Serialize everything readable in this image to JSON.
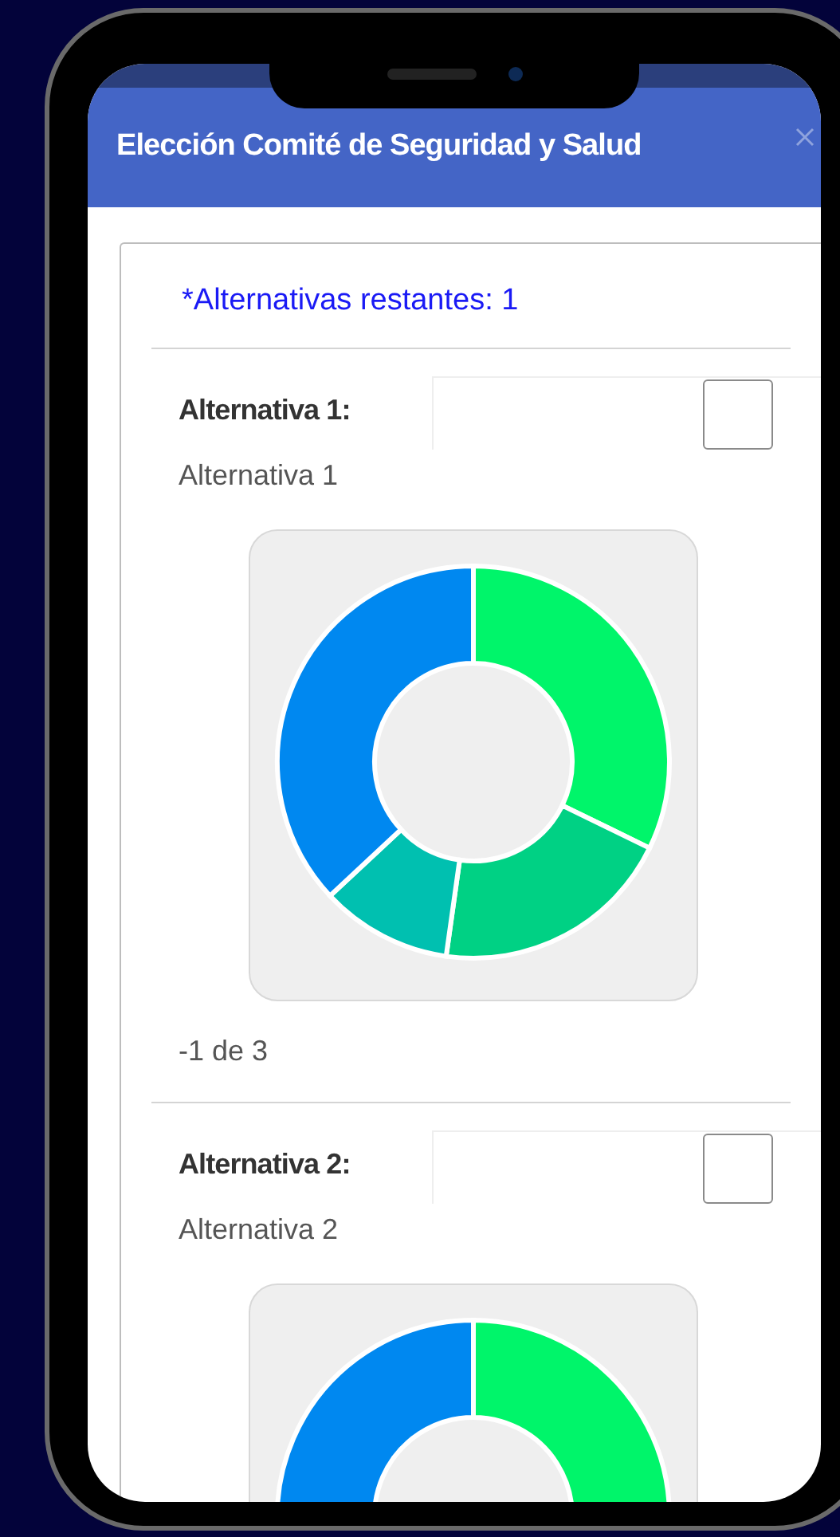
{
  "window": {
    "title": "Elección Comité de Seguridad y Salud"
  },
  "remaining": "*Alternativas restantes: 1",
  "alternatives": [
    {
      "label": "Alternativa 1:",
      "name": "Alternativa 1",
      "checked": false,
      "count": "-1 de 3"
    },
    {
      "label": "Alternativa 2:",
      "name": "Alternativa 2",
      "checked": false
    }
  ]
}
